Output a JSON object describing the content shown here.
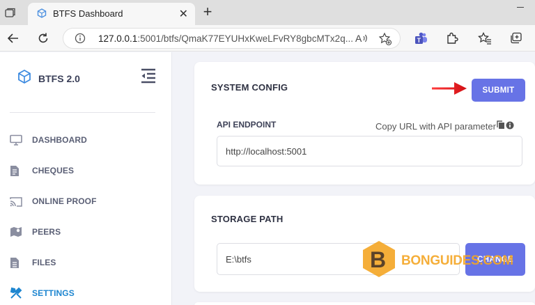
{
  "browser": {
    "tab": {
      "title": "BTFS Dashboard",
      "close": "✕"
    },
    "new_tab": "+",
    "address": {
      "host": "127.0.0.1",
      "rest": ":5001/btfs/QmaK77EYUHxKweLFvRY8gbcMTx2q..."
    },
    "read_aloud": "A",
    "icons": [
      "back-icon",
      "refresh-icon",
      "info-icon",
      "read-aloud-icon",
      "add-favorite-icon",
      "teams-icon",
      "extensions-icon",
      "favorites-icon",
      "collections-icon"
    ]
  },
  "sidebar": {
    "brand": "BTFS 2.0",
    "items": [
      {
        "label": "DASHBOARD",
        "icon": "monitor-icon"
      },
      {
        "label": "CHEQUES",
        "icon": "document-icon"
      },
      {
        "label": "ONLINE PROOF",
        "icon": "cast-icon"
      },
      {
        "label": "PEERS",
        "icon": "map-icon"
      },
      {
        "label": "FILES",
        "icon": "file-icon"
      },
      {
        "label": "SETTINGS",
        "icon": "tools-icon",
        "active": true
      }
    ]
  },
  "system_config": {
    "title": "SYSTEM CONFIG",
    "submit": "SUBMIT",
    "api_label": "API ENDPOINT",
    "copy_url": "Copy URL with API parameter",
    "api_value": "http://localhost:5001"
  },
  "storage_path": {
    "title": "STORAGE PATH",
    "value": "E:\\btfs",
    "change": "CHANGE"
  },
  "watermark": {
    "text": "BONGUIDES.COM",
    "letter": "B"
  },
  "colors": {
    "accent": "#6773e6",
    "active_nav": "#1e86d0",
    "arrow": "#e8161b",
    "watermark": "#f4a624"
  }
}
